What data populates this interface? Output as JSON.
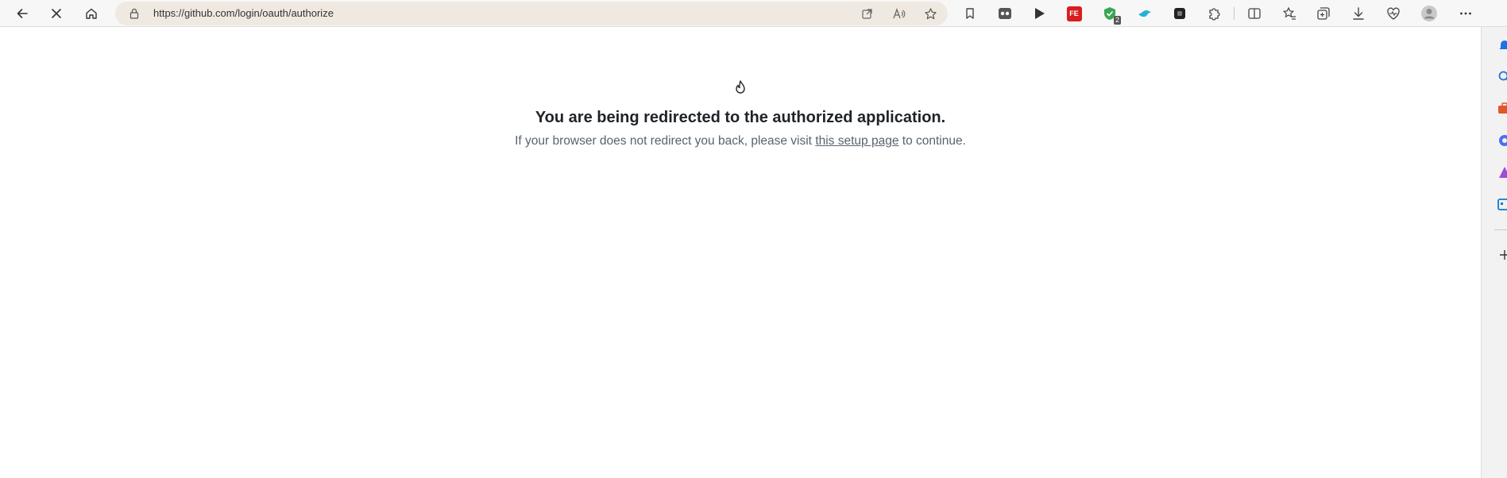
{
  "browser": {
    "url": "https://github.com/login/oauth/authorize",
    "extension_badge_count": "2",
    "extension_fe_label": "FE",
    "icons": {
      "back": "arrow-left-icon",
      "stop": "close-icon",
      "home": "home-icon",
      "lock": "lock-icon",
      "open_app": "open-in-app-icon",
      "read_aloud": "read-aloud-icon",
      "favorite": "star-icon",
      "bookmark": "bookmark-icon",
      "split_screen": "split-screen-icon",
      "favorites": "favorites-icon",
      "collections": "collections-icon",
      "downloads": "download-icon",
      "heartbeat": "browser-essentials-icon",
      "profile": "profile-avatar-icon",
      "menu": "more-icon"
    }
  },
  "page": {
    "heading": "You are being redirected to the authorized application.",
    "text_before_link": "If your browser does not redirect you back, please visit ",
    "link_text": "this setup page",
    "text_after_link": " to continue."
  },
  "colors": {
    "heading": "#1f2328",
    "muted_text": "#59636e",
    "address_bar": "#efe9e2",
    "toolbar": "#f7f7f7"
  }
}
